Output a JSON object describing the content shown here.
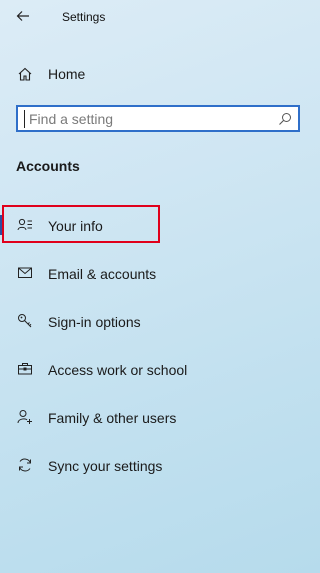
{
  "window": {
    "title": "Settings"
  },
  "nav": {
    "home_label": "Home",
    "section_title": "Accounts",
    "items": [
      {
        "label": "Your info",
        "icon": "person-info-icon",
        "selected": true
      },
      {
        "label": "Email & accounts",
        "icon": "mail-icon",
        "selected": false
      },
      {
        "label": "Sign-in options",
        "icon": "key-icon",
        "selected": false
      },
      {
        "label": "Access work or school",
        "icon": "briefcase-icon",
        "selected": false
      },
      {
        "label": "Family & other users",
        "icon": "person-add-icon",
        "selected": false
      },
      {
        "label": "Sync your settings",
        "icon": "sync-icon",
        "selected": false
      }
    ]
  },
  "search": {
    "placeholder": "Find a setting",
    "value": ""
  },
  "colors": {
    "accent": "#2f6fc9",
    "selection_bar": "#2e4ea0",
    "annotation_red": "#e0001b"
  }
}
